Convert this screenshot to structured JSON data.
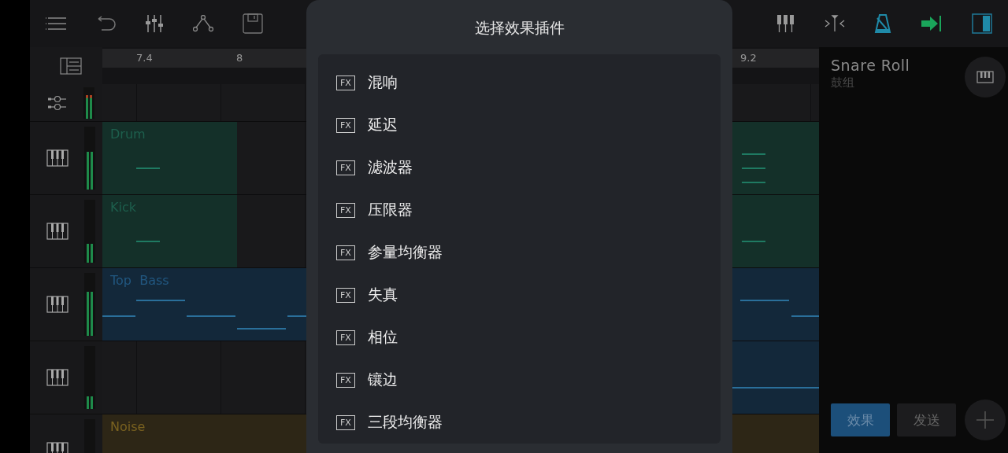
{
  "ruler": {
    "labels": [
      "7.4",
      "8",
      "9.2"
    ]
  },
  "master_meter": {
    "level": 0.75
  },
  "tracks": [
    {
      "clip": "Drum",
      "color": "#143029",
      "meter": {
        "level": 0.6
      }
    },
    {
      "clip": "Kick",
      "color": "#143029",
      "meter": {
        "level": 0.3
      }
    },
    {
      "clip": "Top  Bass",
      "color": "#13283a",
      "meter": {
        "level": 0.7
      }
    },
    {
      "color": "#13283a",
      "meter": {
        "level": 0.2
      }
    },
    {
      "clip": "Noise",
      "color": "#2d2616"
    }
  ],
  "dialog": {
    "title": "选择效果插件",
    "items": [
      {
        "badge": "FX",
        "label": "混响"
      },
      {
        "badge": "FX",
        "label": "延迟"
      },
      {
        "badge": "FX",
        "label": "滤波器"
      },
      {
        "badge": "FX",
        "label": "压限器"
      },
      {
        "badge": "FX",
        "label": "参量均衡器"
      },
      {
        "badge": "FX",
        "label": "失真"
      },
      {
        "badge": "FX",
        "label": "相位"
      },
      {
        "badge": "FX",
        "label": "镶边"
      },
      {
        "badge": "FX",
        "label": "三段均衡器"
      }
    ]
  },
  "instrument": {
    "name": "Snare Roll",
    "group": "鼓组"
  },
  "tabs": [
    {
      "label": "效果",
      "selected": true
    },
    {
      "label": "发送",
      "selected": false
    }
  ]
}
